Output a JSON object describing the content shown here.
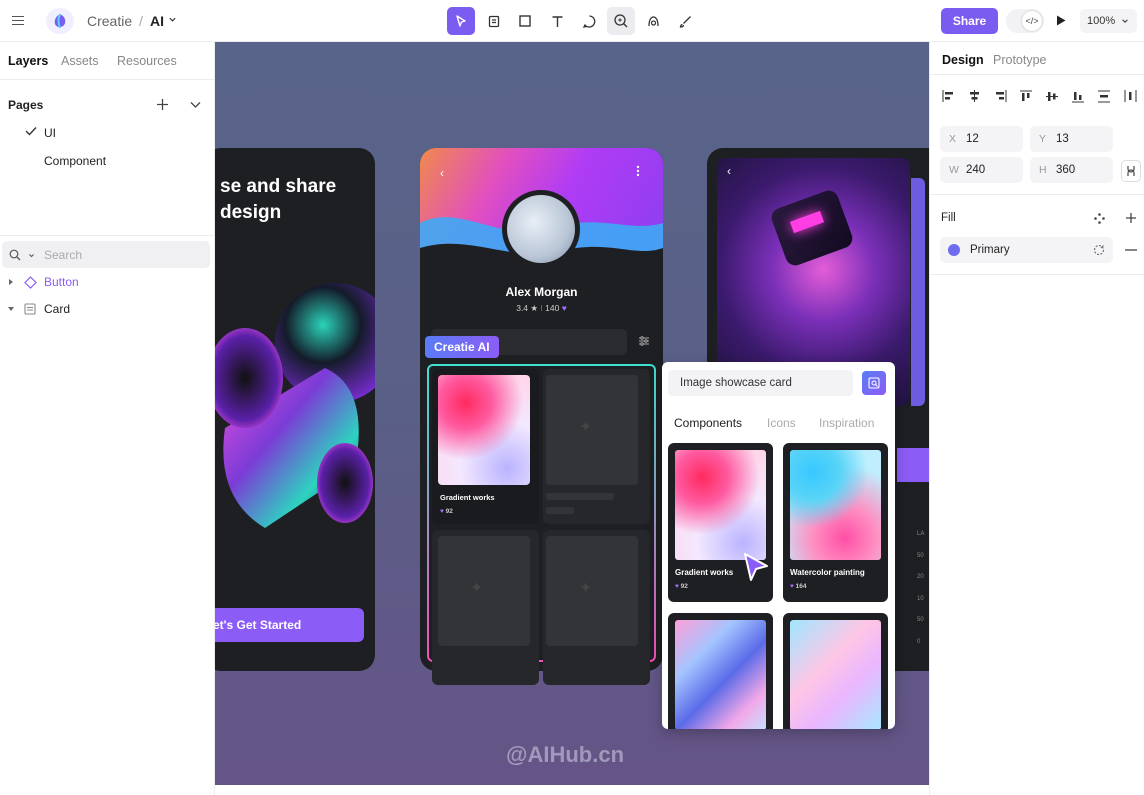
{
  "app": {
    "name": "Creatie",
    "separator": "/",
    "file_name": "AI"
  },
  "toolbar": {
    "tools": [
      "pointer-tool",
      "frame-tool",
      "rectangle-tool",
      "text-tool",
      "comment-tool",
      "ai-tool",
      "component-tool",
      "pen-tool"
    ],
    "share_label": "Share",
    "zoom": "100%"
  },
  "left_panel": {
    "tabs": [
      "Layers",
      "Assets",
      "Resources"
    ],
    "pages_title": "Pages",
    "pages": [
      "UI",
      "Component"
    ],
    "search_placeholder": "Search",
    "layers": [
      {
        "name": "Button",
        "color": "#8b5cf6"
      },
      {
        "name": "Card",
        "color": "#222222"
      }
    ]
  },
  "canvas": {
    "card1": {
      "headline_line1": "se and share",
      "headline_line2": "design",
      "cta": "et's Get Started"
    },
    "card2": {
      "user_name": "Alex Morgan",
      "rating": "3.4",
      "star": "★",
      "sep": "I",
      "likes": "140",
      "ai_badge": "Creatie AI",
      "tile_name": "Gradient works",
      "tile_count": "92"
    },
    "popup": {
      "input_text": "Image showcase card",
      "tabs": [
        "Components",
        "Icons",
        "Inspiration"
      ],
      "cards": [
        {
          "name": "Gradient works",
          "count": "92"
        },
        {
          "name": "Watercolor painting",
          "count": "164"
        }
      ]
    },
    "mini_axis": [
      "LA",
      "50",
      "20",
      "10",
      "50",
      "0"
    ],
    "watermark": "@AIHub.cn"
  },
  "right_panel": {
    "tabs": [
      "Design",
      "Prototype"
    ],
    "x": "12",
    "y": "13",
    "w": "240",
    "h": "360",
    "labels": {
      "x": "X",
      "y": "Y",
      "w": "W",
      "h": "H"
    },
    "fill_title": "Fill",
    "fill_name": "Primary",
    "fill_color": "#6d6cf0"
  },
  "colors": {
    "accent": "#7b5cf0"
  }
}
